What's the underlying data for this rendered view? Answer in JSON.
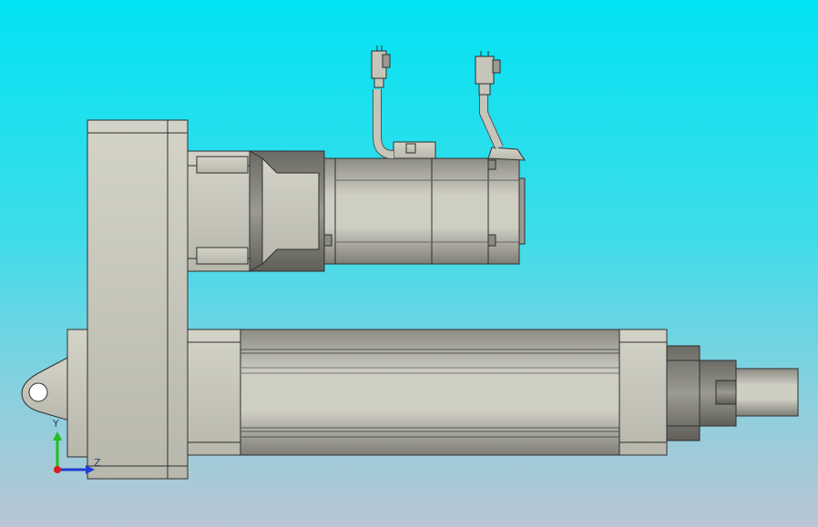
{
  "viewport": {
    "background_top": "#00e3f3",
    "background_bottom": "#b9c5d3",
    "part_color": "#c6c5b9",
    "edge_color": "#2e2e2e"
  },
  "triad": {
    "y_label": "Y",
    "z_label": "Z",
    "y_color": "#1fbf1f",
    "z_color": "#1e3fd6",
    "origin_color": "#d41f1f"
  }
}
